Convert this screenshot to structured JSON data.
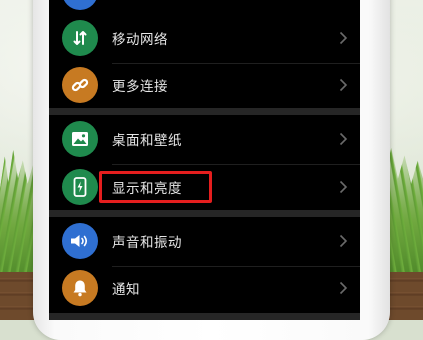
{
  "settings": {
    "items": [
      {
        "label": "移动网络",
        "icon": "mobile-data-icon",
        "icon_color": "#1f8a4d"
      },
      {
        "label": "更多连接",
        "icon": "link-icon",
        "icon_color": "#c77a22"
      },
      {
        "label": "桌面和壁纸",
        "icon": "image-icon",
        "icon_color": "#1f8a4d"
      },
      {
        "label": "显示和亮度",
        "icon": "phone-brightness-icon",
        "icon_color": "#1f8a4d"
      },
      {
        "label": "声音和振动",
        "icon": "volume-icon",
        "icon_color": "#2f6fd1"
      },
      {
        "label": "通知",
        "icon": "bell-icon",
        "icon_color": "#c77a22"
      }
    ],
    "highlighted_item": "显示和亮度",
    "highlight_color": "#e51e1e"
  }
}
